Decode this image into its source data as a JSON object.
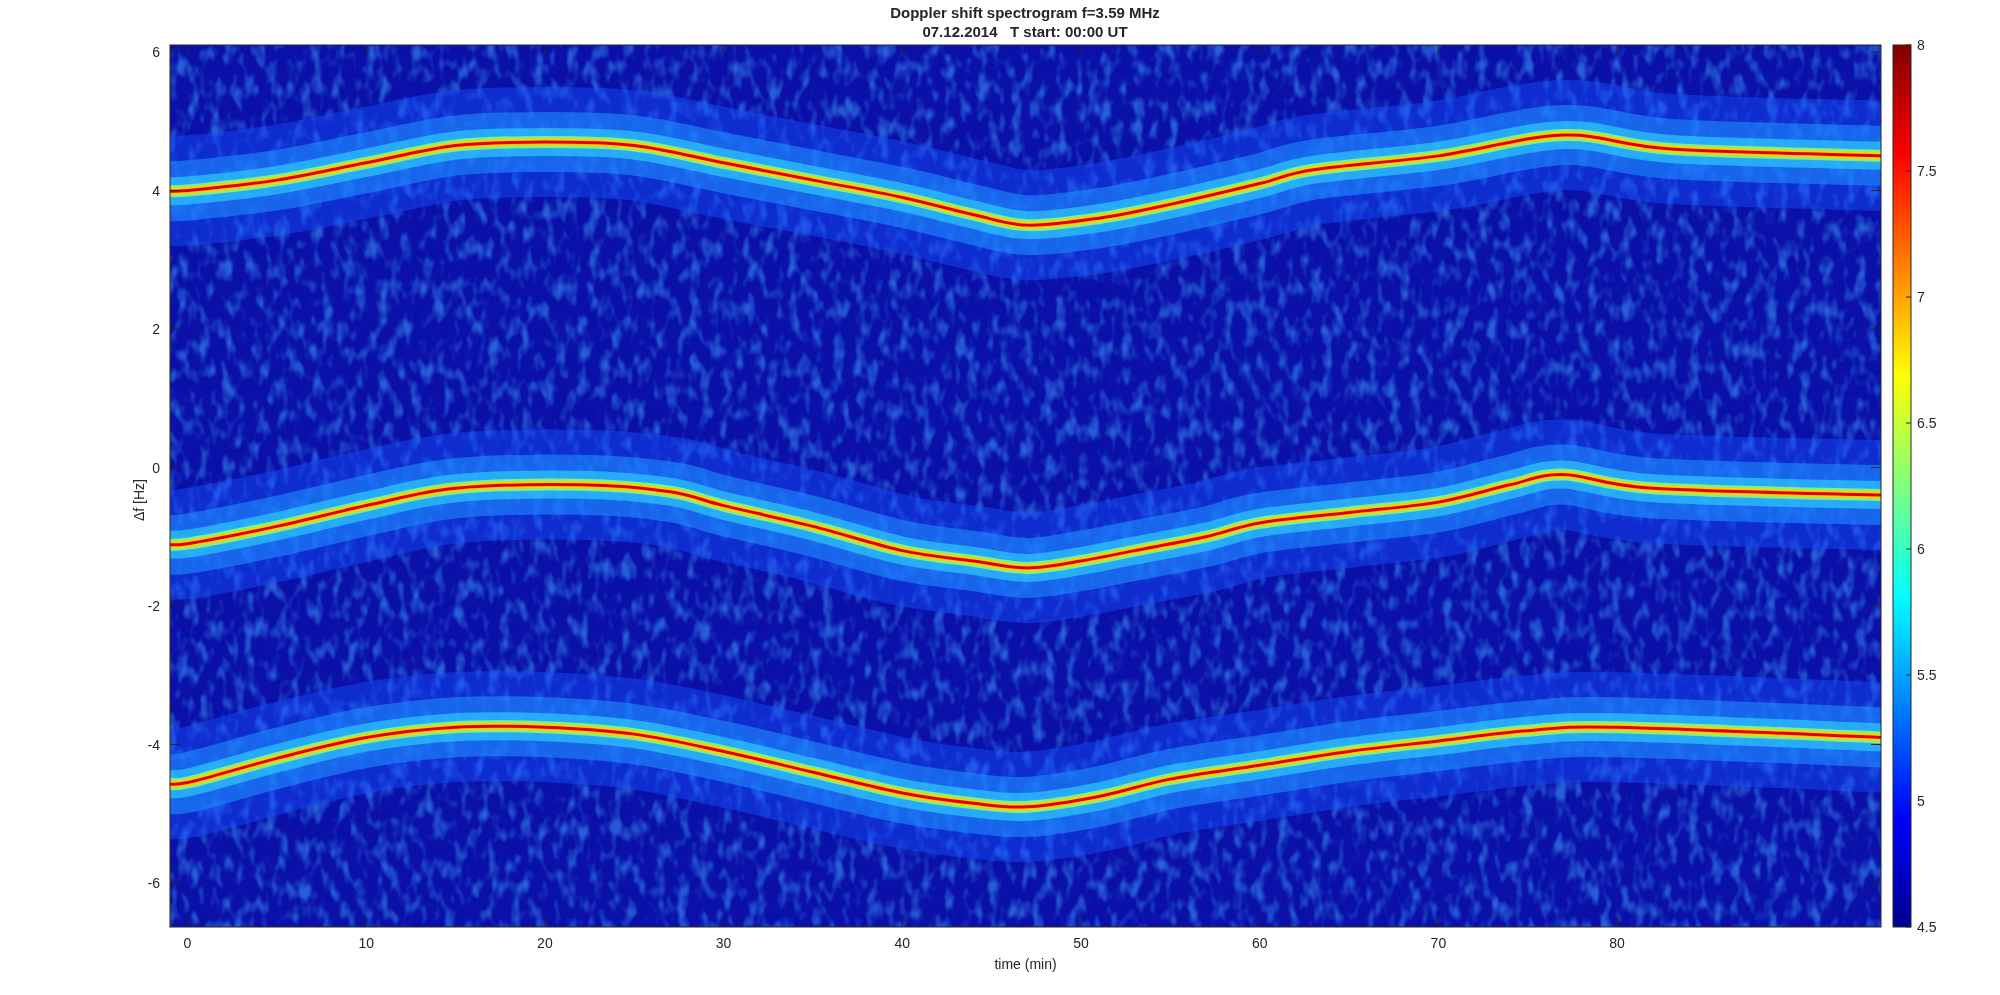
{
  "title": "Doppler shift spectrogram f=3.59 MHz",
  "subtitle": "07.12.2014   T start: 00:00 UT",
  "x_axis": {
    "label": "time (min)",
    "ticks": [
      "0",
      "10",
      "20",
      "30",
      "40",
      "50",
      "60",
      "70",
      "80"
    ]
  },
  "y_axis": {
    "label": "Δf [Hz]",
    "ticks": [
      "6",
      "4",
      "2",
      "0",
      "-2",
      "-4",
      "-6"
    ]
  },
  "colorbar": {
    "ticks": [
      "8",
      "7.5",
      "7",
      "6.5",
      "6",
      "5.5",
      "5",
      "4.5"
    ]
  }
}
